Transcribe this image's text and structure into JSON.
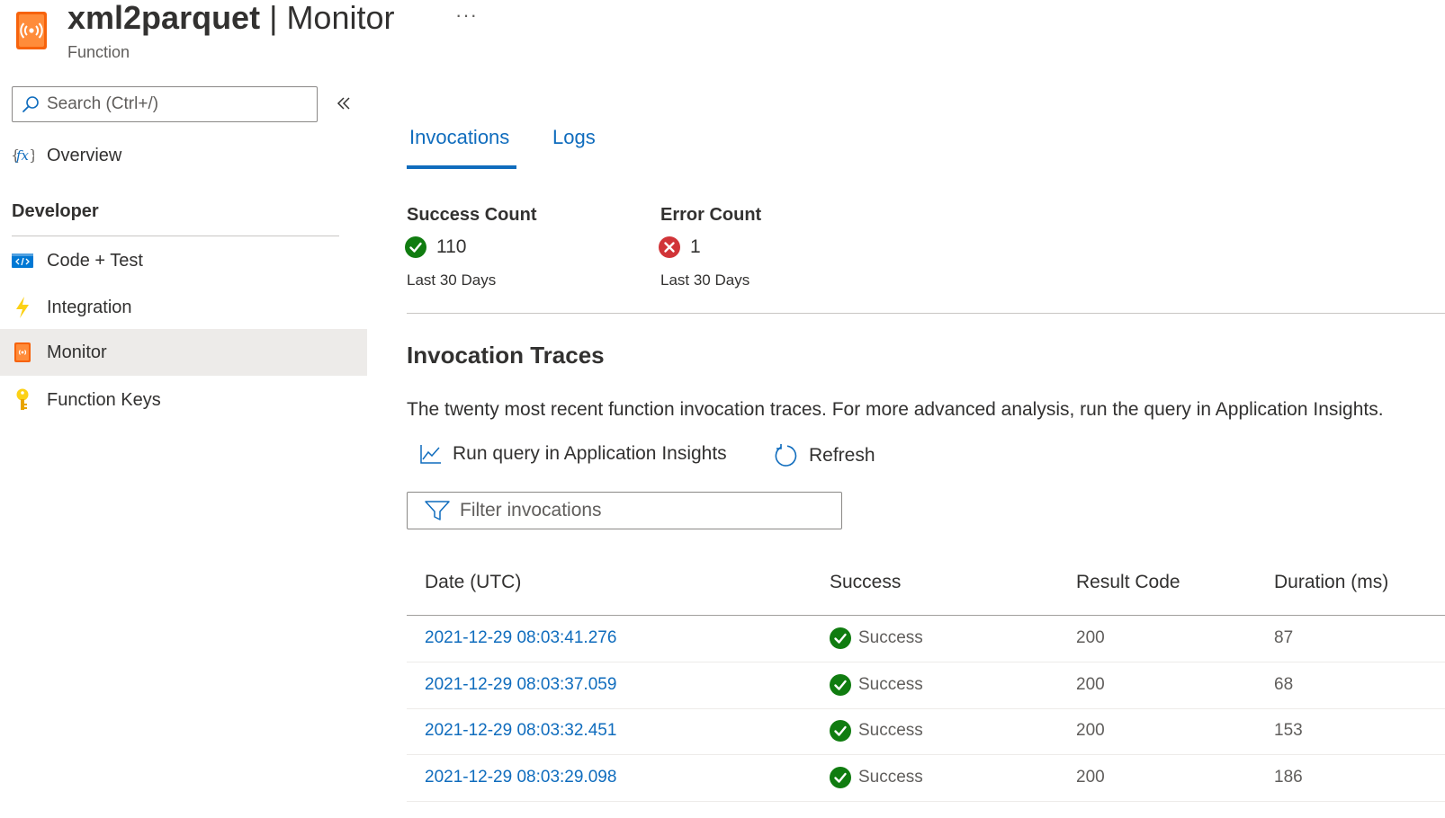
{
  "header": {
    "app_name": "xml2parquet",
    "separator": "|",
    "page_name": "Monitor",
    "more_label": "···",
    "subtitle": "Function",
    "icon": "monitor-function-icon"
  },
  "sidebar": {
    "search_placeholder": "Search (Ctrl+/)",
    "collapse_icon": "double-chevron-left-icon",
    "overview_label": "Overview",
    "section_title": "Developer",
    "items": [
      {
        "label": "Code + Test",
        "icon": "code-icon"
      },
      {
        "label": "Integration",
        "icon": "lightning-icon"
      },
      {
        "label": "Monitor",
        "icon": "monitor-icon",
        "active": true
      },
      {
        "label": "Function Keys",
        "icon": "key-icon"
      }
    ]
  },
  "tabs": [
    {
      "label": "Invocations",
      "active": true
    },
    {
      "label": "Logs",
      "active": false
    }
  ],
  "stats": {
    "success": {
      "label": "Success Count",
      "value": "110",
      "period": "Last 30 Days"
    },
    "error": {
      "label": "Error Count",
      "value": "1",
      "period": "Last 30 Days"
    }
  },
  "traces": {
    "title": "Invocation Traces",
    "description": "The twenty most recent function invocation traces. For more advanced analysis, run the query in Application Insights.",
    "run_query_label": "Run query in Application Insights",
    "refresh_label": "Refresh",
    "filter_placeholder": "Filter invocations",
    "columns": [
      "Date (UTC)",
      "Success",
      "Result Code",
      "Duration (ms)"
    ],
    "rows": [
      {
        "date": "2021-12-29 08:03:41.276",
        "success": "Success",
        "code": "200",
        "duration": "87"
      },
      {
        "date": "2021-12-29 08:03:37.059",
        "success": "Success",
        "code": "200",
        "duration": "68"
      },
      {
        "date": "2021-12-29 08:03:32.451",
        "success": "Success",
        "code": "200",
        "duration": "153"
      },
      {
        "date": "2021-12-29 08:03:29.098",
        "success": "Success",
        "code": "200",
        "duration": "186"
      }
    ]
  },
  "colors": {
    "accent": "#0f6cbd",
    "success": "#107c10",
    "error": "#d13438",
    "monitor_orange": "#f7630c"
  }
}
